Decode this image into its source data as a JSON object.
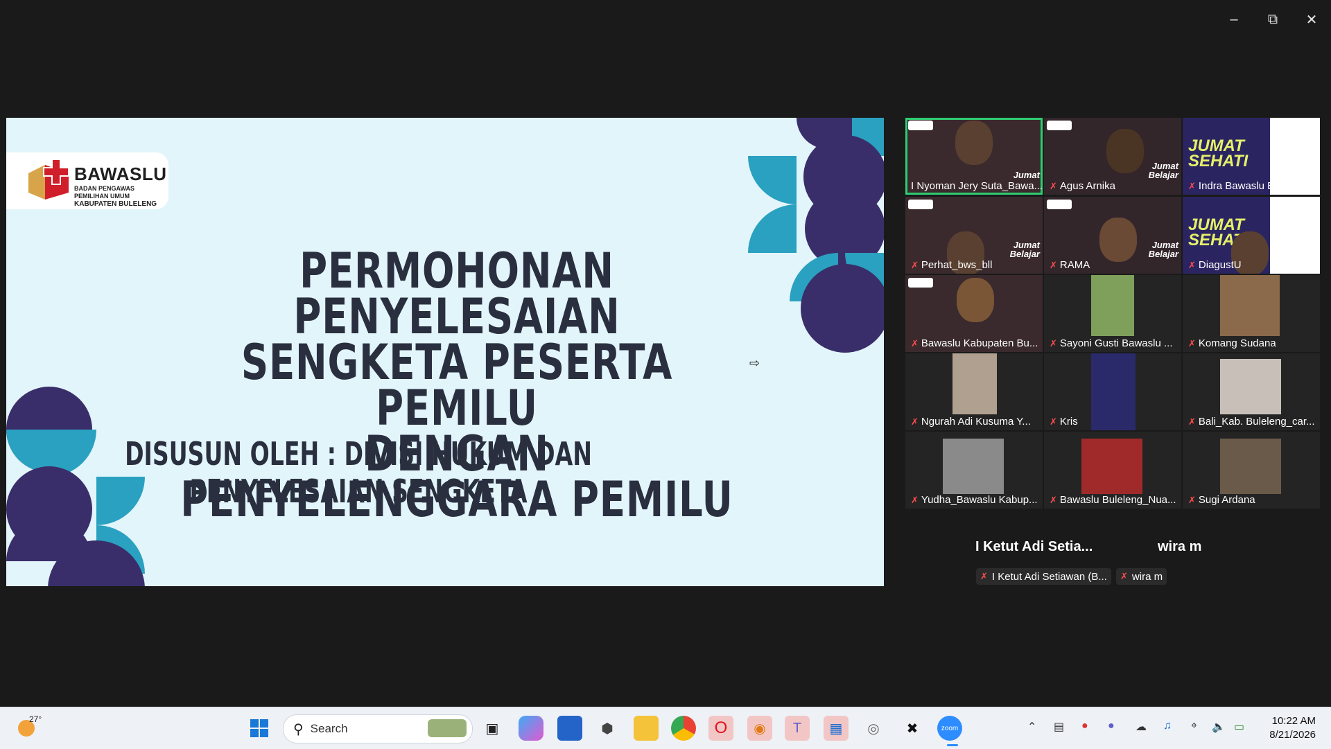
{
  "window": {
    "minimize_icon": "minimize-icon",
    "restore_icon": "restore-icon",
    "close_icon": "close-icon"
  },
  "slide": {
    "logo_name": "BAWASLU",
    "logo_sub1": "BADAN PENGAWAS PEMILIHAN UMUM",
    "logo_sub2": "KABUPATEN BULELENG",
    "title_line1": "PERMOHONAN PENYELESAIAN",
    "title_line2": "SENGKETA PESERTA PEMILU",
    "title_line3": "DENGAN PENYELENGGARA PEMILU",
    "subtitle": "DISUSUN OLEH : DIVISI HUKUM DAN PENYELESAIAN SENGKETA"
  },
  "participants": [
    {
      "name": "I Nyoman Jery Suta_Bawa...",
      "muted": false
    },
    {
      "name": "Agus Arnika",
      "muted": true
    },
    {
      "name": "Indra Bawaslu Bll",
      "muted": true
    },
    {
      "name": "Perhat_bws_bll",
      "muted": true
    },
    {
      "name": "RAMA",
      "muted": true
    },
    {
      "name": "DiagustU",
      "muted": true
    },
    {
      "name": "Bawaslu Kabupaten Bu...",
      "muted": true
    },
    {
      "name": "Sayoni Gusti Bawaslu ...",
      "muted": true
    },
    {
      "name": "Komang Sudana",
      "muted": true
    },
    {
      "name": "Ngurah Adi Kusuma Y...",
      "muted": true
    },
    {
      "name": "Kris",
      "muted": true
    },
    {
      "name": "Bali_Kab. Buleleng_car...",
      "muted": true
    },
    {
      "name": "Yudha_Bawaslu Kabup...",
      "muted": true
    },
    {
      "name": "Bawaslu Buleleng_Nua...",
      "muted": true
    },
    {
      "name": "Sugi Ardana",
      "muted": true
    }
  ],
  "tile_overlay": {
    "jumat1": "Jumat",
    "jumat2": "Belajar",
    "sehati1": "JUMAT",
    "sehati2": "SEHATI"
  },
  "audio_only": [
    {
      "big_name": "I Ketut Adi Setia...",
      "chip": "I Ketut Adi Setiawan (B..."
    },
    {
      "big_name": "wira m",
      "chip": "wira m"
    }
  ],
  "taskbar": {
    "weather_temp": "27°",
    "search_label": "Search",
    "time": "10:22 AM",
    "date": "8/21/2026",
    "icons": [
      "windows-start-icon",
      "search-icon",
      "task-view-icon",
      "copilot-icon",
      "store-icon",
      "app-icon",
      "file-explorer-icon",
      "chrome-icon",
      "opera-icon",
      "vpn-icon",
      "teams-icon",
      "remote-icon",
      "app-ring-icon",
      "capcut-icon",
      "zoom-icon"
    ],
    "tray_icons": [
      "chevron-up-icon",
      "vmware-icon",
      "record-icon",
      "teams-tray-icon",
      "cloud-off-icon",
      "mic-tray-icon",
      "wifi-icon",
      "volume-icon",
      "battery-icon"
    ]
  }
}
